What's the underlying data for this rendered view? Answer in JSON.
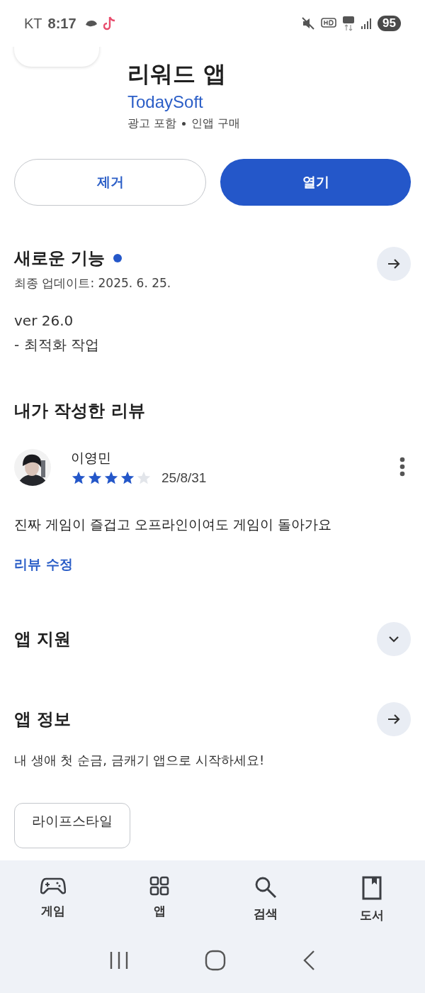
{
  "status_bar": {
    "carrier": "KT",
    "time": "8:17",
    "battery": "95"
  },
  "app": {
    "title": "리워드 앱",
    "developer": "TodaySoft",
    "meta": [
      "광고 포함",
      "인앱 구매"
    ]
  },
  "actions": [
    {
      "kind": "outline",
      "label": "제거"
    },
    {
      "kind": "filled",
      "label": "열기"
    }
  ],
  "whats_new": {
    "title": "새로운 기능",
    "updated": "최종 업데이트: 2025. 6. 25.",
    "lines": [
      "ver 26.0",
      "- 최적화 작업"
    ]
  },
  "my_review": {
    "title": "내가 작성한 리뷰",
    "author": "이영민",
    "stars": 4,
    "date": "25/8/31",
    "text": "진짜 게임이 즐겁고 오프라인이여도 게임이 돌아가요",
    "edit_link": "리뷰 수정"
  },
  "sections": [
    {
      "kind": "expand",
      "title": "앱 지원"
    },
    {
      "kind": "arrow",
      "title": "앱 정보"
    }
  ],
  "app_info": {
    "description": "내 생애 첫 순금, 금캐기 앱으로 시작하세요!",
    "tags": [
      "라이프스타일"
    ]
  },
  "bottom_nav": [
    {
      "kind": "games",
      "label": "게임"
    },
    {
      "kind": "apps",
      "label": "앱"
    },
    {
      "kind": "search",
      "label": "검색"
    },
    {
      "kind": "books",
      "label": "도서"
    }
  ]
}
